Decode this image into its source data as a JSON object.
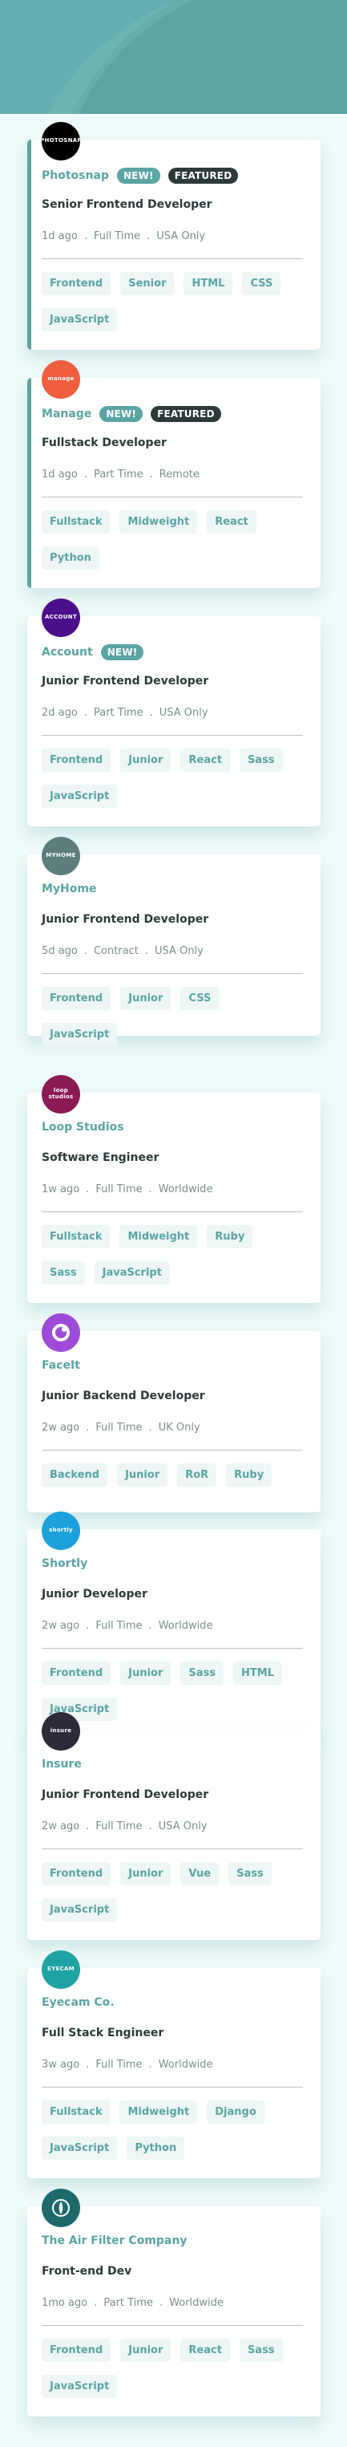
{
  "jobs": [
    {
      "company": "Photosnap",
      "logo_text": "PHOTOSNAP",
      "logo_color": "#000000",
      "new_label": "NEW!",
      "featured_label": "FEATURED",
      "position": "Senior Frontend Developer",
      "posted": "1d ago",
      "contract": "Full Time",
      "location": "USA Only",
      "tags": [
        "Frontend",
        "Senior",
        "HTML",
        "CSS",
        "JavaScript"
      ]
    },
    {
      "company": "Manage",
      "logo_text": "manage",
      "logo_color": "#f15d3d",
      "new_label": "NEW!",
      "featured_label": "FEATURED",
      "position": "Fullstack Developer",
      "posted": "1d ago",
      "contract": "Part Time",
      "location": "Remote",
      "tags": [
        "Fullstack",
        "Midweight",
        "React",
        "Python"
      ]
    },
    {
      "company": "Account",
      "logo_text": "ACCOUNT",
      "logo_color": "#4b0f8a",
      "new_label": "NEW!",
      "position": "Junior Frontend Developer",
      "posted": "2d ago",
      "contract": "Part Time",
      "location": "USA Only",
      "tags": [
        "Frontend",
        "Junior",
        "React",
        "Sass",
        "JavaScript"
      ]
    },
    {
      "company": "MyHome",
      "logo_text": "MYHOME",
      "logo_color": "#5e7e7e",
      "position": "Junior Frontend Developer",
      "posted": "5d ago",
      "contract": "Contract",
      "location": "USA Only",
      "tags": [
        "Frontend",
        "Junior",
        "CSS",
        "JavaScript"
      ]
    },
    {
      "company": "Loop Studios",
      "logo_text": "loop studios",
      "logo_color": "#8c1a55",
      "position": "Software Engineer",
      "posted": "1w ago",
      "contract": "Full Time",
      "location": "Worldwide",
      "tags": [
        "Fullstack",
        "Midweight",
        "Ruby",
        "Sass",
        "JavaScript"
      ]
    },
    {
      "company": "FaceIt",
      "logo_text": "",
      "logo_color": "#9d4ad8",
      "position": "Junior Backend Developer",
      "posted": "2w ago",
      "contract": "Full Time",
      "location": "UK Only",
      "tags": [
        "Backend",
        "Junior",
        "RoR",
        "Ruby"
      ]
    },
    {
      "company": "Shortly",
      "logo_text": "shortly",
      "logo_color": "#1da1dc",
      "position": "Junior Developer",
      "posted": "2w ago",
      "contract": "Full Time",
      "location": "Worldwide",
      "tags": [
        "Frontend",
        "Junior",
        "Sass",
        "HTML",
        "JavaScript"
      ]
    },
    {
      "company": "Insure",
      "logo_text": "insure",
      "logo_color": "#2f2a3a",
      "position": "Junior Frontend Developer",
      "posted": "2w ago",
      "contract": "Full Time",
      "location": "USA Only",
      "tags": [
        "Frontend",
        "Junior",
        "Vue",
        "Sass",
        "JavaScript"
      ]
    },
    {
      "company": "Eyecam Co.",
      "logo_text": "EYECAM",
      "logo_color": "#1fa3a3",
      "position": "Full Stack Engineer",
      "posted": "3w ago",
      "contract": "Full Time",
      "location": "Worldwide",
      "tags": [
        "Fullstack",
        "Midweight",
        "Django",
        "JavaScript",
        "Python"
      ]
    },
    {
      "company": "The Air Filter Company",
      "logo_text": "",
      "logo_color": "#1e6a6a",
      "position": "Front-end Dev",
      "posted": "1mo ago",
      "contract": "Part Time",
      "location": "Worldwide",
      "tags": [
        "Frontend",
        "Junior",
        "React",
        "Sass",
        "JavaScript"
      ]
    }
  ]
}
